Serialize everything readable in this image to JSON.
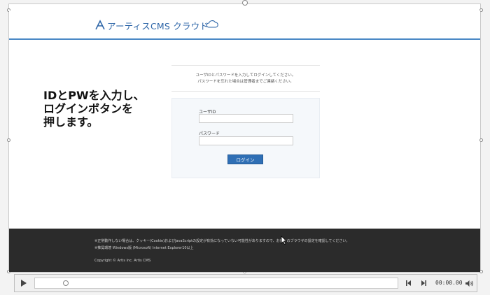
{
  "header": {
    "logo_text": "アーティスCMS クラウド"
  },
  "login": {
    "info_line1": "ユーザIDとパスワードを入力してログインしてください。",
    "info_line2": "パスワードを忘れた場合は管理者までご連絡ください。",
    "userid_label": "ユーザID",
    "userid_value": "",
    "password_label": "パスワード",
    "password_value": "",
    "login_button": "ログイン"
  },
  "annotation": {
    "line1": "IDとPWを入力し、",
    "line2": "ログインボタンを",
    "line3": "押します。"
  },
  "footer": {
    "note1": "※正常動作しない場合は、クッキー(Cookie)およびJavaScriptの設定が有効になっていない可能性がありますので、お使いのブラウザの設定を確認してください。",
    "note2": "※推奨環境 Windows版 (Microsoft) Internet Explorer10以上",
    "copyright": "Copyright © Artis Inc. Artis CMS"
  },
  "media": {
    "time": "00:00.00",
    "icons": [
      "play-icon",
      "step-back-icon",
      "step-forward-icon",
      "volume-icon"
    ]
  },
  "colors": {
    "accent": "#4a88c6",
    "button": "#2f6fb5",
    "footer_bg": "#2b2b2b"
  }
}
